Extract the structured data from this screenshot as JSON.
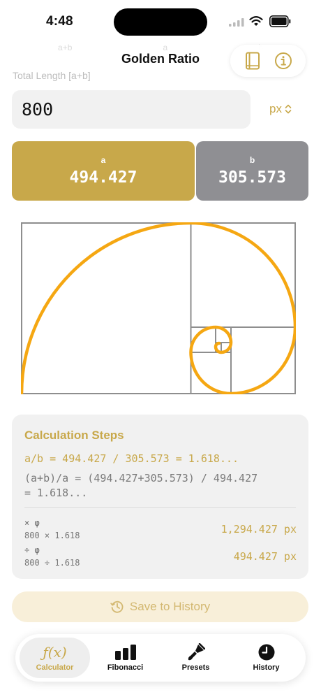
{
  "status_bar": {
    "time": "4:48"
  },
  "header": {
    "title": "Golden Ratio",
    "ghost_tabs": [
      "a+b",
      "a",
      "b"
    ],
    "length_label": "Total Length [a+b]"
  },
  "input": {
    "value": "800",
    "unit": "px"
  },
  "segments": {
    "a": {
      "label": "a",
      "value": "494.427"
    },
    "b": {
      "label": "b",
      "value": "305.573"
    }
  },
  "calculation": {
    "title": "Calculation Steps",
    "line1": "a/b = 494.427 / 305.573 = 1.618...",
    "line2": "(a+b)/a = (494.427+305.573) / 494.427",
    "line3": "= 1.618...",
    "multiply": {
      "label": "× φ",
      "expr": "800 × 1.618",
      "result": "1,294.427 px"
    },
    "divide": {
      "label": "÷ φ",
      "expr": "800 ÷ 1.618",
      "result": "494.427 px"
    }
  },
  "save_button": {
    "label": "Save to History"
  },
  "tabs": [
    {
      "label": "Calculator"
    },
    {
      "label": "Fibonacci"
    },
    {
      "label": "Presets"
    },
    {
      "label": "History"
    }
  ],
  "colors": {
    "accent": "#c8a84a",
    "spiral": "#f5a712",
    "segment_b": "#8f8f93",
    "card": "#f1f1f1"
  }
}
